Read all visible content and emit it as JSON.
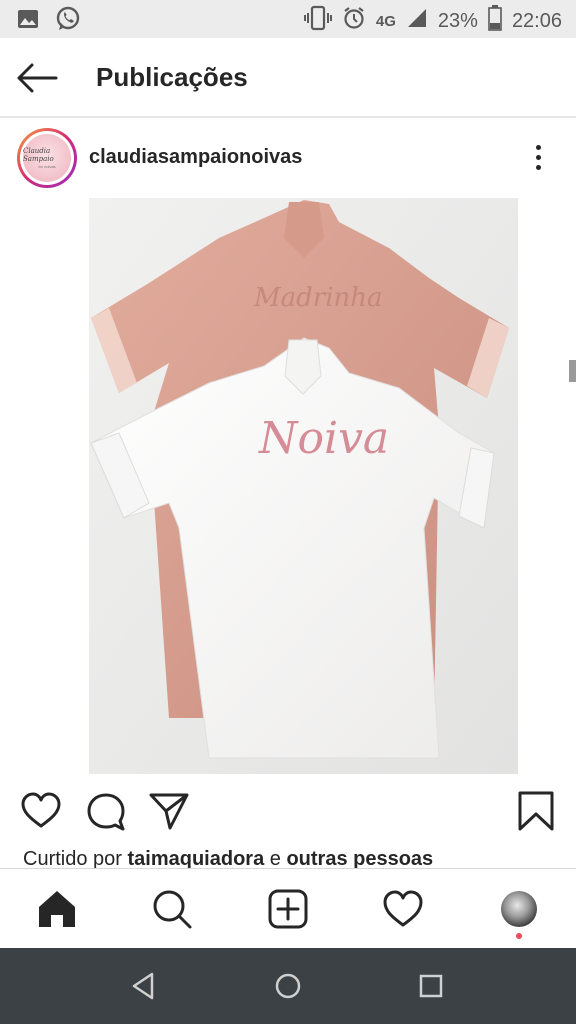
{
  "status_bar": {
    "network": "4G",
    "battery": "23%",
    "time": "22:06",
    "icons": [
      "image-icon",
      "whatsapp-icon",
      "vibrate-icon",
      "alarm-icon",
      "signal-icon",
      "battery-icon"
    ]
  },
  "app_bar": {
    "title": "Publicações",
    "back_icon": "arrow-left-icon"
  },
  "post": {
    "username": "claudiasampaionoivas",
    "avatar_text_1": "Claudia Sampaio",
    "avatar_text_2": "for noivas",
    "image_embroidery_text": "Noiva",
    "liked_by_prefix": "Curtido por",
    "liked_by_user": "taimaquiadora",
    "liked_by_joiner": "e",
    "liked_by_others": "outras pessoas",
    "actions": [
      "heart-icon",
      "comment-icon",
      "share-icon",
      "bookmark-icon"
    ]
  },
  "bottom_nav": {
    "items": [
      "home-icon",
      "search-icon",
      "add-post-icon",
      "activity-heart-icon",
      "profile-avatar"
    ]
  },
  "system_nav": {
    "items": [
      "back-triangle-icon",
      "home-circle-icon",
      "recents-square-icon"
    ]
  },
  "colors": {
    "status_bar_bg": "#ececec",
    "system_nav_bg": "#3b4145",
    "text": "#262626",
    "notification_dot": "#ed4956",
    "robe_pink": "#d9a090",
    "robe_white": "#f8f8f6",
    "embroidery_pink": "#d58c96"
  }
}
